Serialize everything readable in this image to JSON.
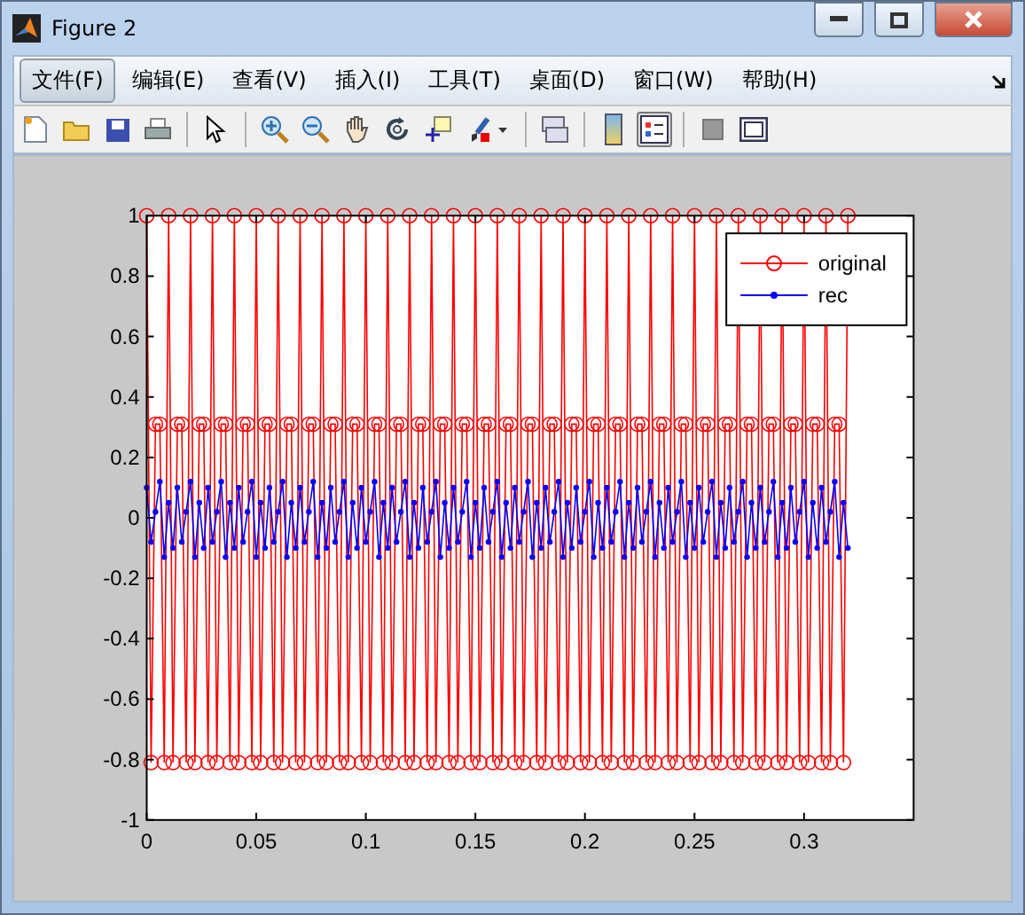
{
  "window": {
    "title": "Figure 2"
  },
  "menu": [
    {
      "label": "文件(F)",
      "selected": true
    },
    {
      "label": "编辑(E)",
      "selected": false
    },
    {
      "label": "查看(V)",
      "selected": false
    },
    {
      "label": "插入(I)",
      "selected": false
    },
    {
      "label": "工具(T)",
      "selected": false
    },
    {
      "label": "桌面(D)",
      "selected": false
    },
    {
      "label": "窗口(W)",
      "selected": false
    },
    {
      "label": "帮助(H)",
      "selected": false
    }
  ],
  "toolbar": [
    {
      "pressed": false
    },
    {
      "pressed": false
    },
    {
      "pressed": false
    },
    {
      "pressed": false
    },
    {
      "pressed": false
    },
    {
      "pressed": false
    },
    {
      "pressed": false
    },
    {
      "pressed": false
    },
    {
      "pressed": false
    },
    {
      "pressed": false
    },
    {
      "pressed": false
    },
    {
      "pressed": false
    },
    {
      "pressed": false
    },
    {
      "pressed": true
    },
    {
      "pressed": false
    },
    {
      "pressed": false
    }
  ],
  "figure": {
    "chart_data": {
      "type": "line",
      "xlim": [
        0,
        0.35
      ],
      "ylim": [
        -1,
        1
      ],
      "legend": true,
      "xticks": [
        0,
        0.05,
        0.1,
        0.15,
        0.2,
        0.25,
        0.3
      ],
      "yticks": [
        1,
        0.8,
        0.6,
        0.4,
        0.2,
        0,
        -0.2,
        -0.4,
        -0.6,
        -0.8,
        -1
      ],
      "x": [
        0,
        0.002,
        0.004,
        0.006,
        0.008,
        0.01,
        0.012,
        0.014,
        0.016,
        0.018,
        0.02,
        0.022,
        0.024,
        0.026,
        0.028,
        0.03,
        0.032,
        0.034,
        0.036,
        0.038,
        0.04,
        0.042,
        0.044,
        0.046,
        0.048,
        0.05,
        0.052,
        0.054,
        0.056,
        0.058,
        0.06,
        0.062,
        0.064,
        0.066,
        0.068,
        0.07,
        0.072,
        0.074,
        0.076,
        0.078,
        0.08,
        0.082,
        0.084,
        0.086,
        0.088,
        0.09,
        0.092,
        0.094,
        0.096,
        0.098,
        0.1,
        0.102,
        0.104,
        0.106,
        0.108,
        0.11,
        0.112,
        0.114,
        0.116,
        0.118,
        0.12,
        0.122,
        0.124,
        0.126,
        0.128,
        0.13,
        0.132,
        0.134,
        0.136,
        0.138,
        0.14,
        0.142,
        0.144,
        0.146,
        0.148,
        0.15,
        0.152,
        0.154,
        0.156,
        0.158,
        0.16,
        0.162,
        0.164,
        0.166,
        0.168,
        0.17,
        0.172,
        0.174,
        0.176,
        0.178,
        0.18,
        0.182,
        0.184,
        0.186,
        0.188,
        0.19,
        0.192,
        0.194,
        0.196,
        0.198,
        0.2,
        0.202,
        0.204,
        0.206,
        0.208,
        0.21,
        0.212,
        0.214,
        0.216,
        0.218,
        0.22,
        0.222,
        0.224,
        0.226,
        0.228,
        0.23,
        0.232,
        0.234,
        0.236,
        0.238,
        0.24,
        0.242,
        0.244,
        0.246,
        0.248,
        0.25,
        0.252,
        0.254,
        0.256,
        0.258,
        0.26,
        0.262,
        0.264,
        0.266,
        0.268,
        0.27,
        0.272,
        0.274,
        0.276,
        0.278,
        0.28,
        0.282,
        0.284,
        0.286,
        0.288,
        0.29,
        0.292,
        0.294,
        0.296,
        0.298,
        0.3,
        0.302,
        0.304,
        0.306,
        0.308,
        0.31,
        0.312,
        0.314,
        0.316,
        0.318,
        0.32
      ],
      "series": [
        {
          "name": "original",
          "color": "#ff0000",
          "marker": "o",
          "values": [
            1,
            -0.81,
            0.31,
            0.31,
            -0.81,
            1,
            -0.81,
            0.31,
            0.31,
            -0.81,
            1,
            -0.81,
            0.31,
            0.31,
            -0.81,
            1,
            -0.81,
            0.31,
            0.31,
            -0.81,
            1,
            -0.81,
            0.31,
            0.31,
            -0.81,
            1,
            -0.81,
            0.31,
            0.31,
            -0.81,
            1,
            -0.81,
            0.31,
            0.31,
            -0.81,
            1,
            -0.81,
            0.31,
            0.31,
            -0.81,
            1,
            -0.81,
            0.31,
            0.31,
            -0.81,
            1,
            -0.81,
            0.31,
            0.31,
            -0.81,
            1,
            -0.81,
            0.31,
            0.31,
            -0.81,
            1,
            -0.81,
            0.31,
            0.31,
            -0.81,
            1,
            -0.81,
            0.31,
            0.31,
            -0.81,
            1,
            -0.81,
            0.31,
            0.31,
            -0.81,
            1,
            -0.81,
            0.31,
            0.31,
            -0.81,
            1,
            -0.81,
            0.31,
            0.31,
            -0.81,
            1,
            -0.81,
            0.31,
            0.31,
            -0.81,
            1,
            -0.81,
            0.31,
            0.31,
            -0.81,
            1,
            -0.81,
            0.31,
            0.31,
            -0.81,
            1,
            -0.81,
            0.31,
            0.31,
            -0.81,
            1,
            -0.81,
            0.31,
            0.31,
            -0.81,
            1,
            -0.81,
            0.31,
            0.31,
            -0.81,
            1,
            -0.81,
            0.31,
            0.31,
            -0.81,
            1,
            -0.81,
            0.31,
            0.31,
            -0.81,
            1,
            -0.81,
            0.31,
            0.31,
            -0.81,
            1,
            -0.81,
            0.31,
            0.31,
            -0.81,
            1,
            -0.81,
            0.31,
            0.31,
            -0.81,
            1,
            -0.81,
            0.31,
            0.31,
            -0.81,
            1,
            -0.81,
            0.31,
            0.31,
            -0.81,
            1,
            -0.81,
            0.31,
            0.31,
            -0.81,
            1,
            -0.81,
            0.31,
            0.31,
            -0.81,
            1,
            -0.81,
            0.31,
            0.31,
            -0.81,
            1
          ]
        },
        {
          "name": "rec",
          "color": "#0000ff",
          "marker": ".",
          "values": [
            0.1,
            -0.08,
            0.02,
            0.12,
            -0.13,
            0.05,
            -0.1,
            0.1,
            -0.08,
            0.02,
            0.12,
            -0.13,
            0.05,
            -0.1,
            0.1,
            -0.08,
            0.02,
            0.12,
            -0.13,
            0.05,
            -0.1,
            0.1,
            -0.08,
            0.02,
            0.12,
            -0.13,
            0.05,
            -0.1,
            0.1,
            -0.08,
            0.02,
            0.12,
            -0.13,
            0.05,
            -0.1,
            0.1,
            -0.08,
            0.02,
            0.12,
            -0.13,
            0.05,
            -0.1,
            0.1,
            -0.08,
            0.02,
            0.12,
            -0.13,
            0.05,
            -0.1,
            0.1,
            -0.08,
            0.02,
            0.12,
            -0.13,
            0.05,
            -0.1,
            0.1,
            -0.08,
            0.02,
            0.12,
            -0.13,
            0.05,
            -0.1,
            0.1,
            -0.08,
            0.02,
            0.12,
            -0.13,
            0.05,
            -0.1,
            0.1,
            -0.08,
            0.02,
            0.12,
            -0.13,
            0.05,
            -0.1,
            0.1,
            -0.08,
            0.02,
            0.12,
            -0.13,
            0.05,
            -0.1,
            0.1,
            -0.08,
            0.02,
            0.12,
            -0.13,
            0.05,
            -0.1,
            0.1,
            -0.08,
            0.02,
            0.12,
            -0.13,
            0.05,
            -0.1,
            0.1,
            -0.08,
            0.02,
            0.12,
            -0.13,
            0.05,
            -0.1,
            0.1,
            -0.08,
            0.02,
            0.12,
            -0.13,
            0.05,
            -0.1,
            0.1,
            -0.08,
            0.02,
            0.12,
            -0.13,
            0.05,
            -0.1,
            0.1,
            -0.08,
            0.02,
            0.12,
            -0.13,
            0.05,
            -0.1,
            0.1,
            -0.08,
            0.02,
            0.12,
            -0.13,
            0.05,
            -0.1,
            0.1,
            -0.08,
            0.02,
            0.12,
            -0.13,
            0.05,
            -0.1,
            0.1,
            -0.08,
            0.02,
            0.12,
            -0.13,
            0.05,
            -0.1,
            0.1,
            -0.08,
            0.02,
            0.12,
            -0.13,
            0.05,
            -0.1,
            0.1,
            -0.08,
            0.02,
            0.12,
            -0.13,
            0.05,
            -0.1
          ]
        }
      ]
    }
  }
}
